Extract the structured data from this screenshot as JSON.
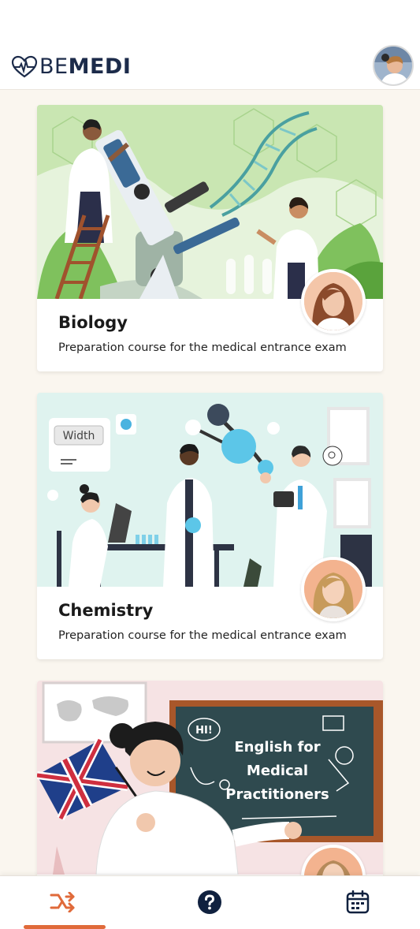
{
  "app": {
    "logo_part1": "BE",
    "logo_part2": "MEDI"
  },
  "colors": {
    "brand_navy": "#1c2b4a",
    "accent_orange": "#e06a3a",
    "background": "#faf6ef"
  },
  "courses": [
    {
      "title": "Biology",
      "description": "Preparation course for the medical entrance exam",
      "illustration": "scientists-with-microscope-and-dna"
    },
    {
      "title": "Chemistry",
      "description": "Preparation course for the medical entrance exam",
      "illustration": "chemistry-lab",
      "image_text": {
        "width_label": "Width"
      }
    },
    {
      "title": "",
      "description": "",
      "illustration": "english-teacher-at-chalkboard",
      "image_text": {
        "speech": "HI!",
        "board_line1": "English for",
        "board_line2": "Medical",
        "board_line3": "Practitioners"
      }
    }
  ],
  "bottom_nav": [
    {
      "icon": "courses-route-icon",
      "active": true
    },
    {
      "icon": "help-icon",
      "active": false
    },
    {
      "icon": "calendar-icon",
      "active": false
    }
  ]
}
